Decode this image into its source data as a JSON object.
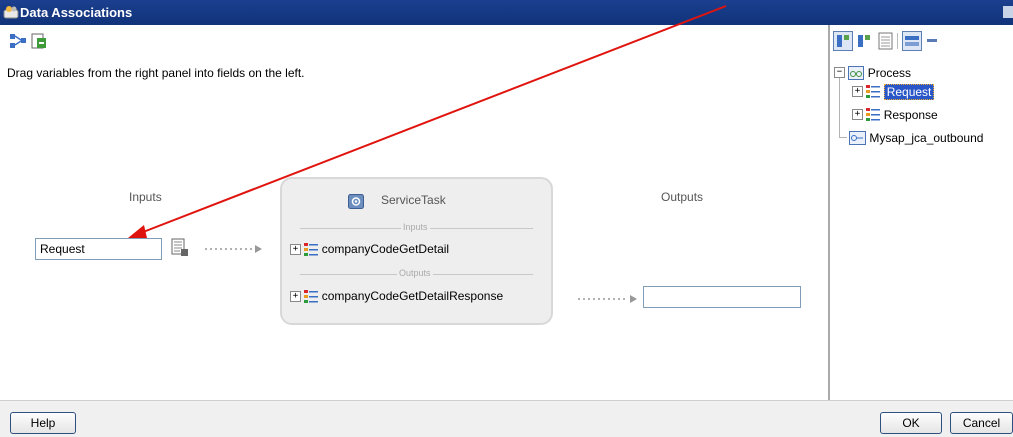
{
  "window": {
    "title": "Data Associations"
  },
  "instruction": "Drag variables from the right panel into fields on the left.",
  "inputs": {
    "label": "Inputs",
    "field_value": "Request"
  },
  "outputs": {
    "label": "Outputs",
    "field_value": ""
  },
  "service_task": {
    "title": "ServiceTask",
    "inputs_label": "Inputs",
    "outputs_label": "Outputs",
    "input_item": "companyCodeGetDetail",
    "output_item": "companyCodeGetDetailResponse"
  },
  "tree": {
    "root": "Process",
    "request": "Request",
    "response": "Response",
    "outbound": "Mysap_jca_outbound"
  },
  "buttons": {
    "help": "Help",
    "ok": "OK",
    "cancel": "Cancel"
  },
  "colors": {
    "titlebar": "#10337a",
    "selection": "#2a57c7",
    "arrow": "#e0140e"
  }
}
